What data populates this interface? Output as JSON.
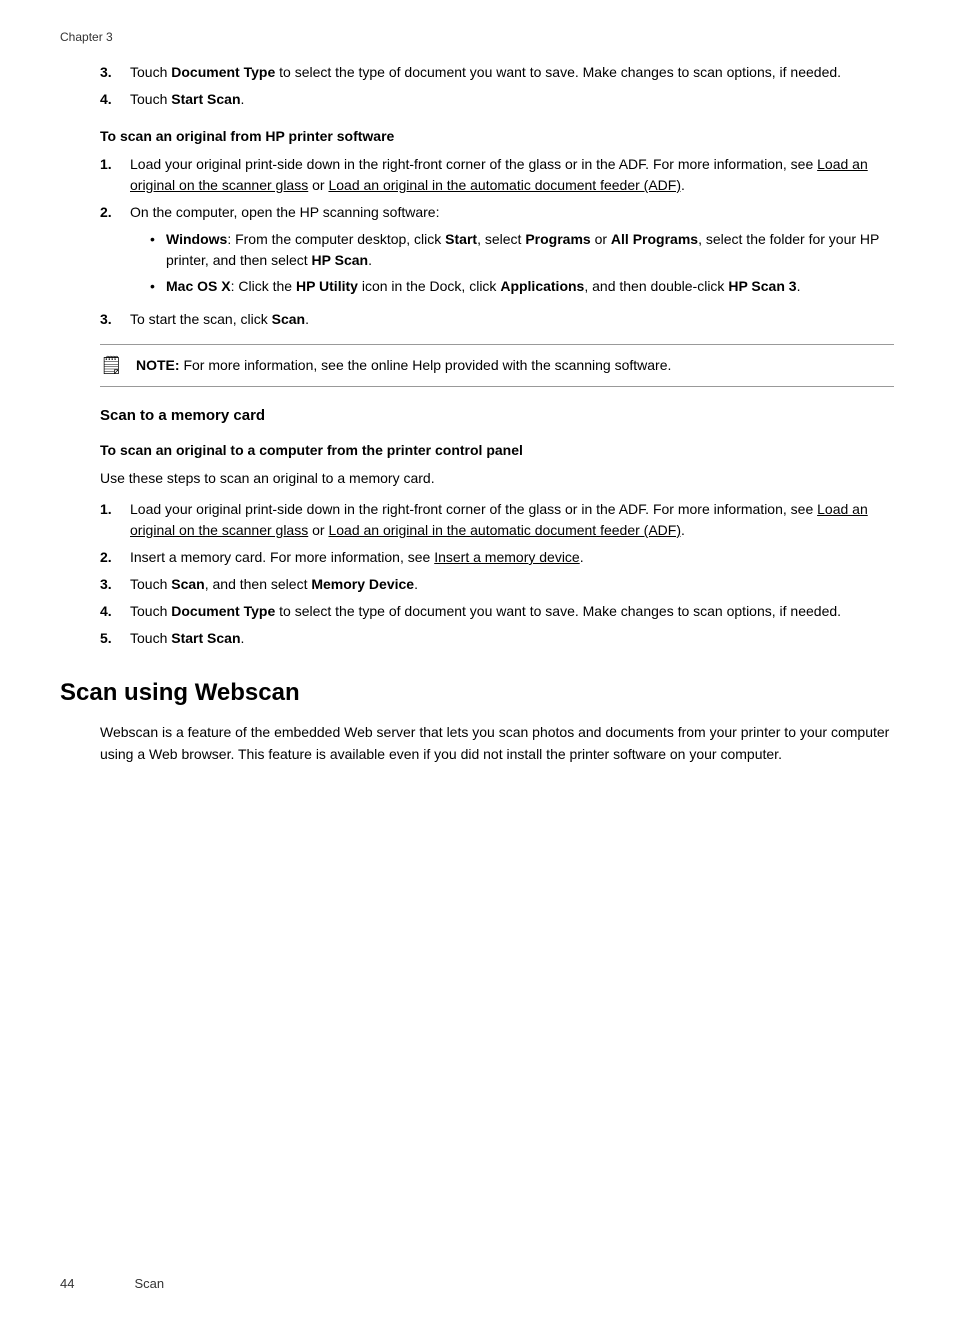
{
  "chapter_header": "Chapter 3",
  "step3_prefix": "3.",
  "step3_text_part1": "Touch ",
  "step3_bold1": "Document Type",
  "step3_text_part2": " to select the type of document you want to save. Make changes to scan options, if needed.",
  "step4_prefix": "4.",
  "step4_text_part1": "Touch ",
  "step4_bold1": "Start Scan",
  "step4_text_part2": ".",
  "section_heading": "To scan an original from HP printer software",
  "s1_prefix": "1.",
  "s1_text": "Load your original print-side down in the right-front corner of the glass or in the ADF. For more information, see ",
  "s1_link1": "Load an original on the scanner glass",
  "s1_or": " or ",
  "s1_link2": "Load an original in the automatic document feeder (ADF)",
  "s1_end": ".",
  "s2_prefix": "2.",
  "s2_text": "On the computer, open the HP scanning software:",
  "bullet1_bold1": "Windows",
  "bullet1_text1": ": From the computer desktop, click ",
  "bullet1_bold2": "Start",
  "bullet1_text2": ", select ",
  "bullet1_bold3": "Programs",
  "bullet1_text3": " or ",
  "bullet1_bold4": "All Programs",
  "bullet1_text4": ", select the folder for your HP printer, and then select ",
  "bullet1_bold5": "HP Scan",
  "bullet1_text5": ".",
  "bullet2_bold1": "Mac OS X",
  "bullet2_text1": ": Click the ",
  "bullet2_bold2": "HP Utility",
  "bullet2_text2": " icon in the Dock, click ",
  "bullet2_bold3": "Applications",
  "bullet2_text3": ", and then double-click ",
  "bullet2_bold4": "HP Scan 3",
  "bullet2_text4": ".",
  "s3_prefix": "3.",
  "s3_text_part1": "To start the scan, click ",
  "s3_bold1": "Scan",
  "s3_text_part2": ".",
  "note_label": "NOTE:",
  "note_text": "   For more information, see the online Help provided with the scanning software.",
  "scan_memory_heading": "Scan to a memory card",
  "scan_control_heading": "To scan an original to a computer from the printer control panel",
  "use_steps_text": "Use these steps to scan an original to a memory card.",
  "m1_prefix": "1.",
  "m1_text": "Load your original print-side down in the right-front corner of the glass or in the ADF. For more information, see ",
  "m1_link1": "Load an original on the scanner glass",
  "m1_or": " or ",
  "m1_link2": "Load an original in the automatic document feeder (ADF)",
  "m1_end": ".",
  "m2_prefix": "2.",
  "m2_text_part1": "Insert a memory card. For more information, see ",
  "m2_link": "Insert a memory device",
  "m2_end": ".",
  "m3_prefix": "3.",
  "m3_text_part1": "Touch ",
  "m3_bold1": "Scan",
  "m3_text_part2": ", and then select ",
  "m3_bold2": "Memory Device",
  "m3_text_part3": ".",
  "m4_prefix": "4.",
  "m4_text_part1": "Touch ",
  "m4_bold1": "Document Type",
  "m4_text_part2": " to select the type of document you want to save. Make changes to scan options, if needed.",
  "m5_prefix": "5.",
  "m5_text_part1": "Touch ",
  "m5_bold1": "Start Scan",
  "m5_text_part2": ".",
  "webscan_heading": "Scan using Webscan",
  "webscan_intro": "Webscan is a feature of the embedded Web server that lets you scan photos and documents from your printer to your computer using a Web browser. This feature is available even if you did not install the printer software on your computer.",
  "footer_page": "44",
  "footer_section": "Scan"
}
